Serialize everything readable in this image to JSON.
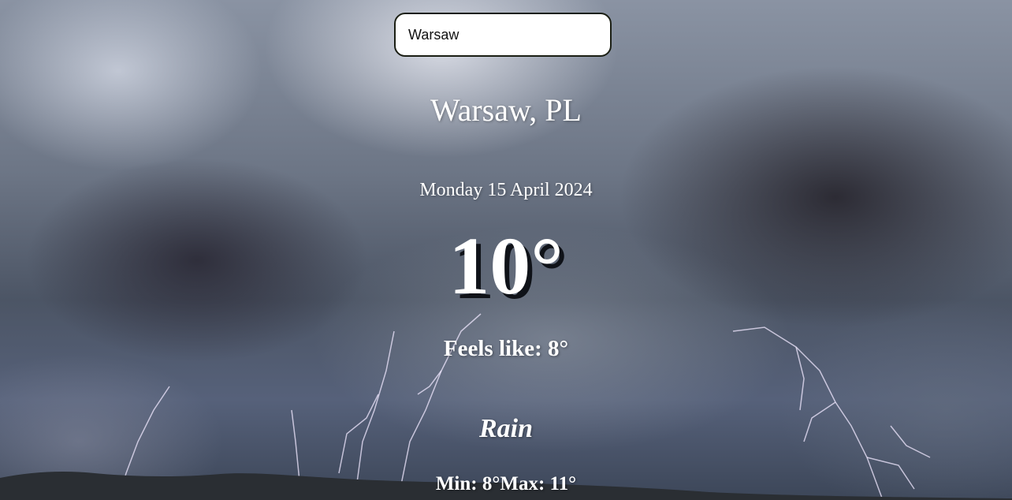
{
  "search": {
    "value": "Warsaw"
  },
  "location": {
    "city": "Warsaw, PL"
  },
  "date": "Monday 15 April 2024",
  "weather": {
    "temperature": "10°",
    "feels_like": "Feels like: 8°",
    "condition": "Rain",
    "min": "Min: 8°",
    "max": "Max: 11°"
  }
}
